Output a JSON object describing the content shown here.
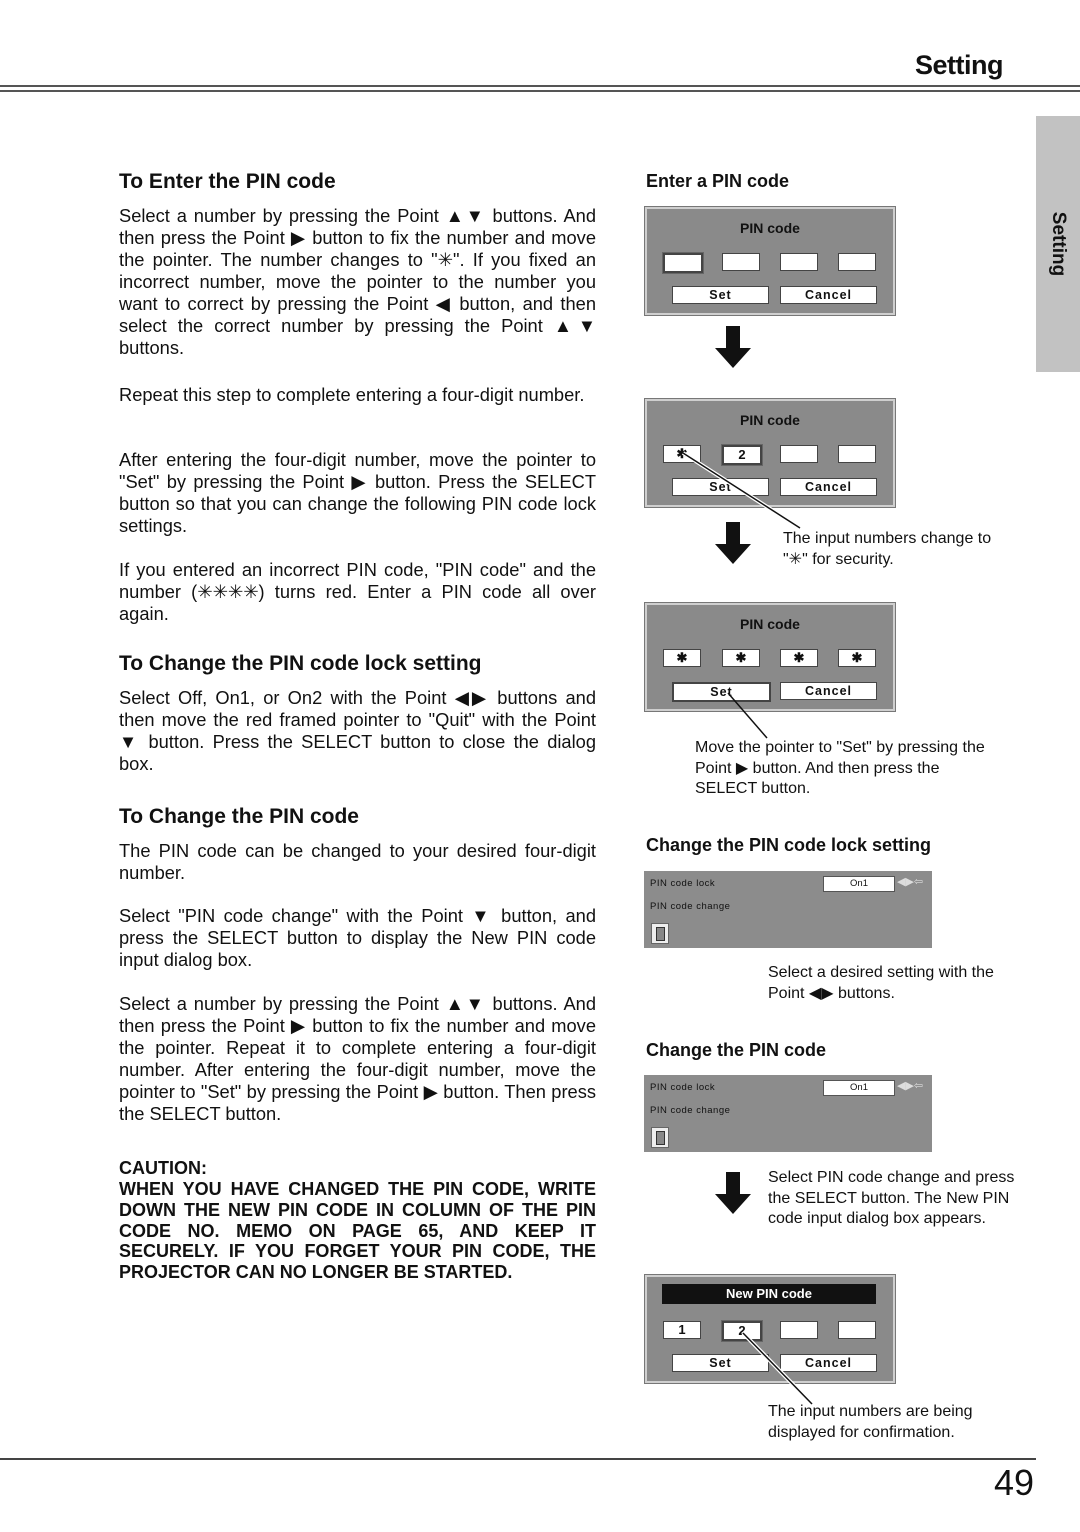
{
  "header": {
    "title": "Setting"
  },
  "side_tab": {
    "label": "Setting"
  },
  "footer": {
    "page_number": "49"
  },
  "left": {
    "enter": {
      "heading": "To Enter the PIN code",
      "p1": "Select a number by pressing the Point ▲▼ buttons. And then press the Point ▶ button to fix the number and move the pointer.  The number changes to \"✳\". If you fixed an incorrect number, move the pointer to the number you want to correct by pressing the Point ◀ button, and then select the correct number by pressing the Point ▲▼ buttons.",
      "p2": "Repeat this step to complete entering a four-digit number.",
      "p3": "After entering the four-digit number, move the pointer to \"Set\" by pressing the Point ▶ button. Press the SELECT button so that you can change the following PIN code lock settings.",
      "p4": "If you entered an incorrect PIN code, \"PIN code\" and the number (✳✳✳✳) turns red.  Enter a PIN code all over again."
    },
    "lock": {
      "heading": "To Change the PIN code lock setting",
      "p1": "Select Off, On1, or On2 with the Point ◀▶ buttons and then move the red framed pointer to \"Quit\" with the Point ▼ button.  Press the SELECT button to close the dialog box."
    },
    "change": {
      "heading": "To Change the PIN code",
      "p1": "The PIN code can be changed to your desired four-digit number.",
      "p2": "Select \"PIN code change\" with the Point ▼ button, and press the SELECT button to display the New PIN code input dialog box.",
      "p3": "Select a number by pressing the Point ▲▼ buttons. And then press the Point ▶ button to fix the number and move the pointer.  Repeat it to complete entering a four-digit number.  After entering the four-digit number, move the pointer to \"Set\" by pressing the Point ▶ button.  Then press the SELECT button."
    },
    "caution": {
      "title": "CAUTION:",
      "body": "WHEN YOU HAVE CHANGED THE PIN CODE, WRITE DOWN THE NEW PIN CODE IN COLUMN OF THE PIN CODE NO. MEMO ON PAGE 65, AND KEEP IT SECURELY. IF YOU FORGET YOUR PIN CODE, THE PROJECTOR CAN NO LONGER BE STARTED."
    }
  },
  "right": {
    "enter_heading": "Enter a PIN code",
    "dialog1": {
      "title": "PIN code",
      "digits": [
        "",
        "",
        "",
        ""
      ],
      "set": "Set",
      "cancel": "Cancel"
    },
    "dialog2": {
      "title": "PIN code",
      "digits": [
        "✱",
        "2",
        "",
        ""
      ],
      "set": "Set",
      "cancel": "Cancel"
    },
    "note2": "The input numbers change to \"✳\" for security.",
    "dialog3": {
      "title": "PIN code",
      "digits": [
        "✱",
        "✱",
        "✱",
        "✱"
      ],
      "set": "Set",
      "cancel": "Cancel"
    },
    "note3": "Move the pointer to \"Set\" by pressing the Point ▶ button.  And then press the SELECT button.",
    "lock_heading": "Change the PIN code lock setting",
    "menu1": {
      "item1": "PIN code lock",
      "item2": "PIN code change",
      "value": "On1",
      "arrows": "◀▶⇦"
    },
    "note_lock": "Select a desired setting with the Point ◀▶ buttons.",
    "change_heading": "Change the PIN code",
    "menu2": {
      "item1": "PIN code lock",
      "item2": "PIN code change",
      "value": "On1",
      "arrows": "◀▶⇦"
    },
    "note_change": "Select PIN code change and press the SELECT button. The New PIN code input dialog box appears.",
    "dialog4": {
      "title": "New PIN code",
      "digits": [
        "1",
        "2",
        "",
        ""
      ],
      "set": "Set",
      "cancel": "Cancel"
    },
    "note4": "The input numbers are being displayed for confirmation."
  }
}
